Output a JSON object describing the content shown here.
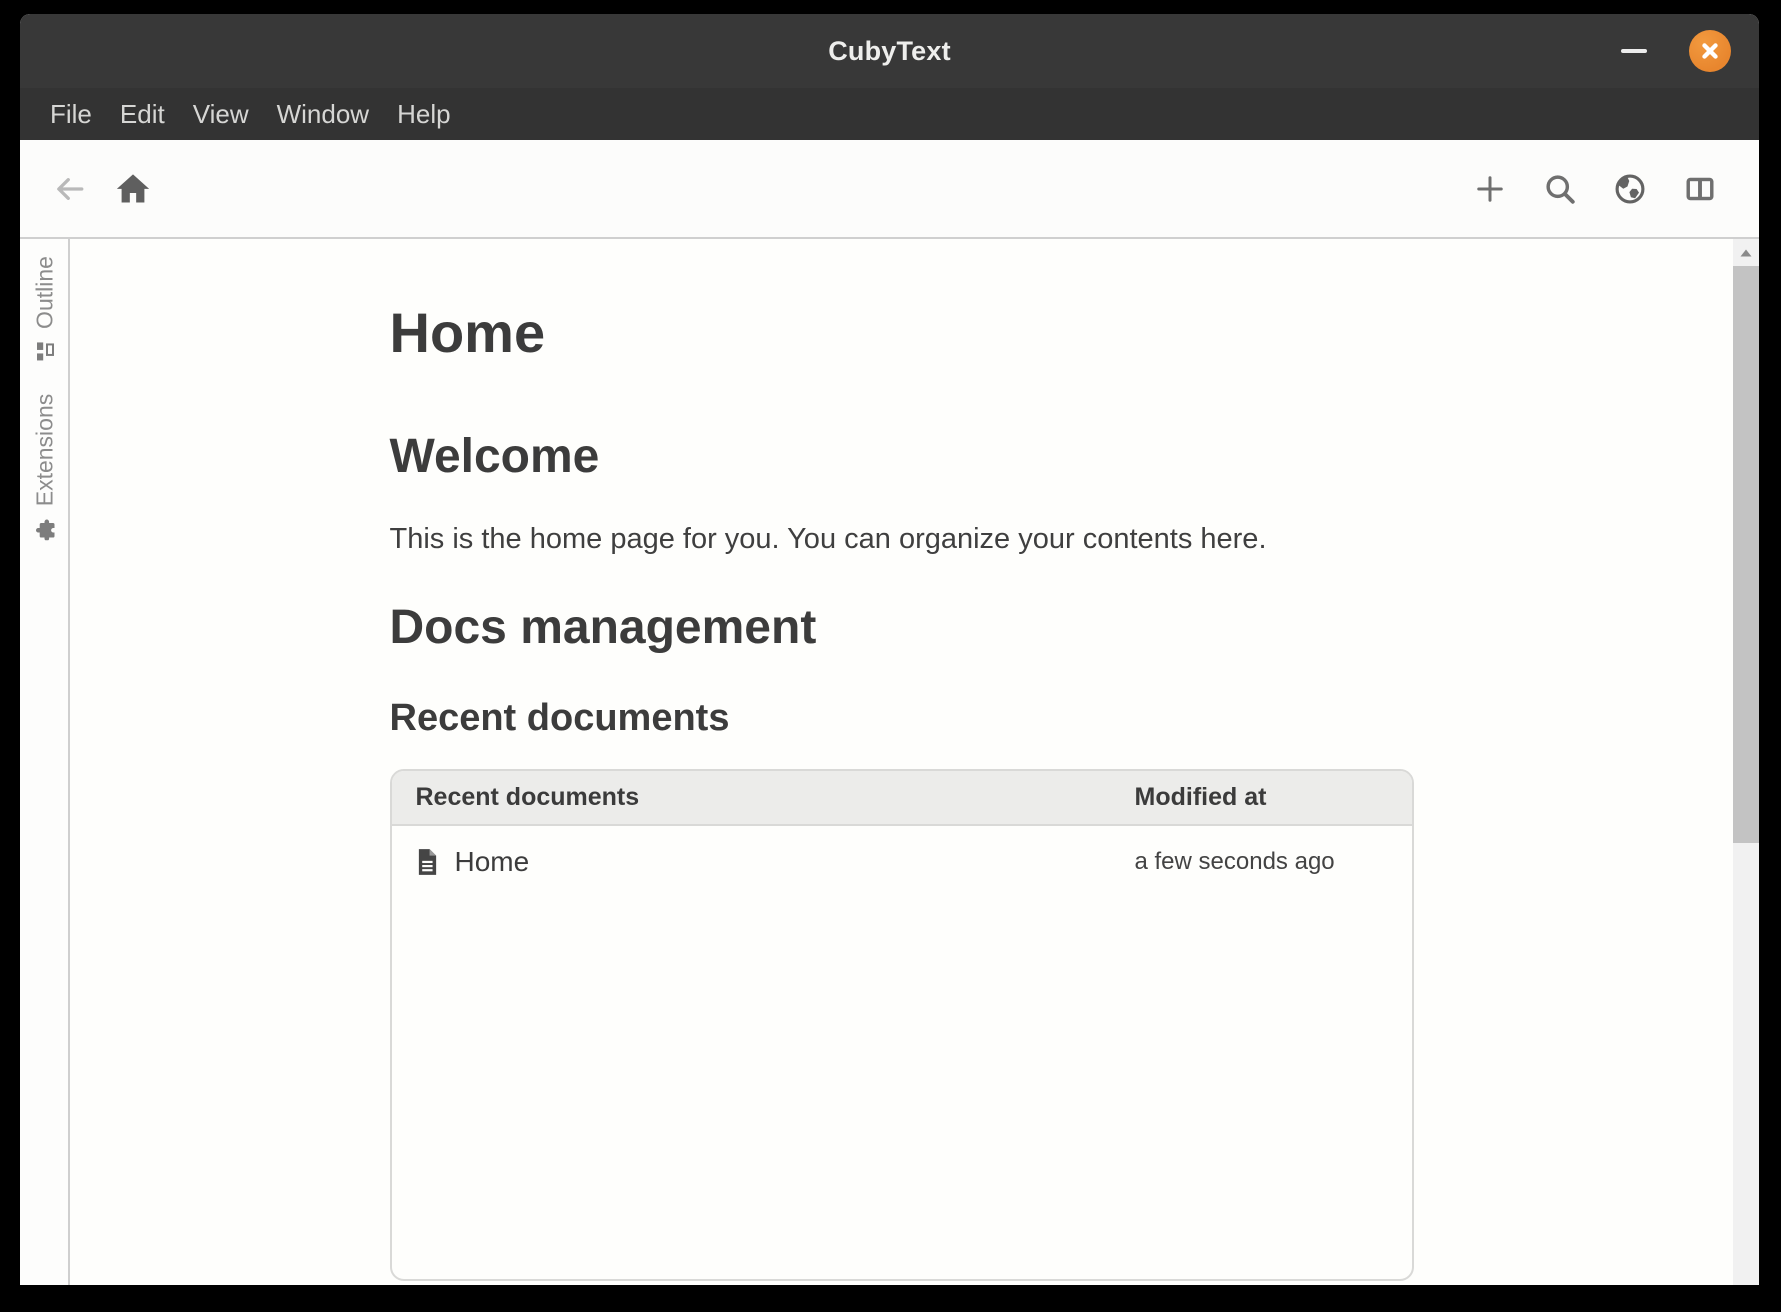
{
  "window": {
    "title": "CubyText"
  },
  "menu_bar": {
    "items": [
      "File",
      "Edit",
      "View",
      "Window",
      "Help"
    ]
  },
  "sidebar": {
    "tabs": [
      {
        "label": "Outline",
        "icon": "outline-tree-icon"
      },
      {
        "label": "Extensions",
        "icon": "puzzle-icon"
      }
    ]
  },
  "content": {
    "doc_title": "Home",
    "welcome_heading": "Welcome",
    "welcome_text": "This is the home page for you. You can organize your contents here.",
    "docs_heading": "Docs management",
    "recent_heading": "Recent documents",
    "table": {
      "columns": [
        "Recent documents",
        "Modified at"
      ],
      "rows": [
        {
          "icon": "document-icon",
          "name": "Home",
          "modified": "a few seconds ago"
        }
      ]
    }
  },
  "colors": {
    "close_button": "#E8862E",
    "titlebar_bg": "#383838",
    "menubar_bg": "#333333",
    "heading_text": "#3C3C3C",
    "table_header_bg": "#ECECEA",
    "scrollbar_thumb": "#C3C3C3",
    "divider": "#CFCFCF"
  }
}
